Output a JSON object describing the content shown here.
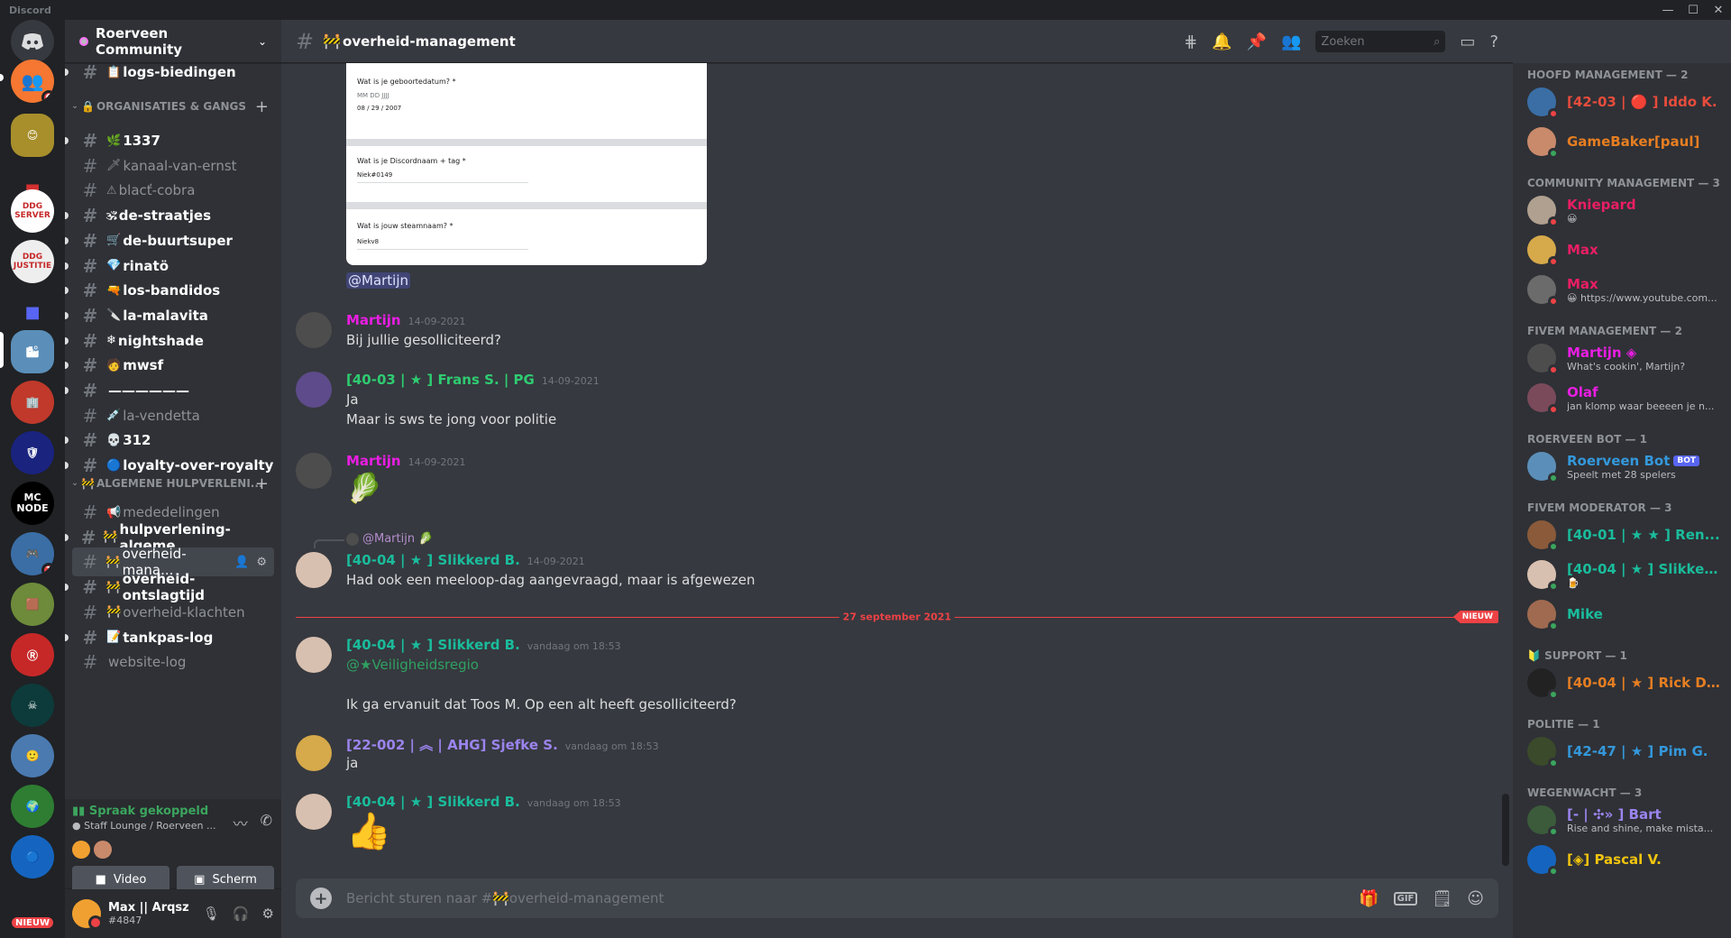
{
  "app": {
    "title": "Discord"
  },
  "window": {
    "minimize": "—",
    "maximize": "☐",
    "close": "✕"
  },
  "rail": {
    "home_label": "Discord",
    "dm_badge": "6",
    "servers": [
      "DDG SERVER",
      "DDG JUSTITIE",
      "MC NODE"
    ],
    "badge_2": "1",
    "nieuw": "NIEUW"
  },
  "guild": {
    "name": "Roerveen Community"
  },
  "channels": {
    "top": {
      "label": "logs-biedingen",
      "emoji": "📋"
    },
    "cat1": "ORGANISATIES & GANGS",
    "group1": [
      {
        "emoji": "🌿",
        "label": "1337"
      },
      {
        "emoji": "🗡",
        "label": "kanaal-van-ernst"
      },
      {
        "emoji": "⚠",
        "label": "blacť-cobra"
      },
      {
        "emoji": "🕉",
        "label": "de-straatjes"
      },
      {
        "emoji": "🛒",
        "label": "de-buurtsuper"
      },
      {
        "emoji": "💎",
        "label": "rinatö"
      },
      {
        "emoji": "🔫",
        "label": "los-bandidos"
      },
      {
        "emoji": "🔪",
        "label": "la-malavita"
      },
      {
        "emoji": "❄",
        "label": "nightshade"
      },
      {
        "emoji": "🧑",
        "label": "mwsf"
      },
      {
        "emoji": "",
        "label": "——————"
      },
      {
        "emoji": "💉",
        "label": "la-vendetta"
      },
      {
        "emoji": "💀",
        "label": "312"
      },
      {
        "emoji": "🔵",
        "label": "loyalty-over-royalty"
      }
    ],
    "cat2": "ALGEMENE HULPVERLENI...",
    "group2": [
      {
        "emoji": "📢",
        "label": "mededelingen"
      },
      {
        "emoji": "🚧",
        "label": "hulpverlening-algeme..."
      },
      {
        "emoji": "🚧",
        "label": "overheid-mana..."
      },
      {
        "emoji": "🚧",
        "label": "overheid-ontslagtijd"
      },
      {
        "emoji": "🚧",
        "label": "overheid-klachten"
      },
      {
        "emoji": "📝",
        "label": "tankpas-log"
      },
      {
        "emoji": "",
        "label": "website-log"
      }
    ]
  },
  "voice": {
    "status": "Spraak gekoppeld",
    "channel": "Staff Lounge / Roerveen ...",
    "video": "Video",
    "screen": "Scherm"
  },
  "user": {
    "name": "Max || Arqsz",
    "tag": "#4847"
  },
  "chat": {
    "channel_emoji": "🚧",
    "channel_name": "overheid-management",
    "search_placeholder": "Zoeken",
    "composer_placeholder": "Bericht sturen naar #🚧overheid-management"
  },
  "form_embed": {
    "q1": "Wat is je geboortedatum? *",
    "q1_fmt": "MM    DD     JJJJ",
    "q1_val": "08  /  29  /  2007",
    "q2": "Wat is je Discordnaam + tag *",
    "q2_val": "Niek#0149",
    "q3": "Wat is jouw steamnaam? *",
    "q3_val": "Niekv8"
  },
  "mention": "@Martijn",
  "messages": [
    {
      "author": "Martijn",
      "color": "#e91ee3",
      "time": "14-09-2021",
      "lines": [
        "Bij jullie gesolliciteerd?"
      ]
    },
    {
      "author": "[40-03 | ★ ] Frans S. | PG",
      "color": "#2ecc71",
      "time": "14-09-2021",
      "lines": [
        "Ja",
        "Maar is sws te jong voor politie"
      ]
    },
    {
      "author": "Martijn",
      "color": "#e91ee3",
      "time": "14-09-2021",
      "lines": [
        "🥬"
      ]
    },
    {
      "reply_to": "@Martijn 🥬",
      "author": "[40-04 | ★ ] Slikkerd B.",
      "color": "#1abc9c",
      "time": "14-09-2021",
      "lines": [
        "Had ook een meeloop-dag aangevraagd, maar is afgewezen"
      ]
    },
    {
      "author": "[40-04 | ★ ] Slikkerd B.",
      "color": "#1abc9c",
      "time": "vandaag om 18:53",
      "lines": [
        "@★Veiligheidsregio",
        "Ik ga ervanuit dat Toos M. Op een alt heeft gesolliciteerd?"
      ]
    },
    {
      "author": "[22-002 | ︽ | AHG] Sjefke S.",
      "color": "#9b84ee",
      "time": "vandaag om 18:53",
      "lines": [
        "ja"
      ]
    },
    {
      "author": "[40-04 | ★ ] Slikkerd B.",
      "color": "#1abc9c",
      "time": "vandaag om 18:53",
      "lines": [
        "👍"
      ]
    }
  ],
  "divider": {
    "date": "27 september 2021",
    "new": "NIEUW"
  },
  "member_groups": [
    {
      "title": "HOOFD MANAGEMENT — 2",
      "members": [
        {
          "name": "[42-03 | 🔴 ] Iddo K.",
          "color": "#e74c3c",
          "status": "",
          "st": "#ed4245"
        },
        {
          "name": "GameBaker[paul]",
          "color": "#e67e22",
          "status": "",
          "st": "#3ba55d"
        }
      ]
    },
    {
      "title": "COMMUNITY MANAGEMENT — 3",
      "members": [
        {
          "name": "Kniepard",
          "color": "#e91e63",
          "status": "😀",
          "st": "#ed4245"
        },
        {
          "name": "Max",
          "color": "#e91e63",
          "status": "",
          "st": "#ed4245"
        },
        {
          "name": "Max",
          "color": "#e91e63",
          "status": "😀 https://www.youtube.com...",
          "st": "#ed4245"
        }
      ]
    },
    {
      "title": "FIVEM MANAGEMENT — 2",
      "members": [
        {
          "name": "Martijn ◈",
          "color": "#e91ee3",
          "status": "What's cookin', Martijn?",
          "st": "#ed4245"
        },
        {
          "name": "Olaf",
          "color": "#e91ee3",
          "status": "jan klomp waar beeeen je n...",
          "st": "#ed4245"
        }
      ]
    },
    {
      "title": "ROERVEEN BOT — 1",
      "members": [
        {
          "name": "Roerveen Bot",
          "color": "#3498db",
          "status": "Speelt met 28 spelers",
          "st": "#3ba55d",
          "bot": "BOT"
        }
      ]
    },
    {
      "title": "FIVEM MODERATOR — 3",
      "members": [
        {
          "name": "[40-01 | ★ ★ ] Ren...",
          "color": "#1abc9c",
          "status": "",
          "st": "#3ba55d"
        },
        {
          "name": "[40-04 | ★ ] Slikkerd B.",
          "color": "#1abc9c",
          "status": "🍺",
          "st": "#3ba55d"
        },
        {
          "name": "Mike",
          "color": "#1abc9c",
          "status": "",
          "st": "#3ba55d"
        }
      ]
    },
    {
      "title": "🔰 SUPPORT — 1",
      "members": [
        {
          "name": "[40-04 | ★ ] Rick D...",
          "color": "#e67e22",
          "status": "",
          "st": "#3ba55d"
        }
      ]
    },
    {
      "title": "POLITIE — 1",
      "members": [
        {
          "name": "[42-47 | ★ ] Pim G.",
          "color": "#3498db",
          "status": "",
          "st": "#3ba55d"
        }
      ]
    },
    {
      "title": "WEGENWACHT — 3",
      "members": [
        {
          "name": "[- | ✣» ] Bart",
          "color": "#9b84ee",
          "status": "Rise and shine, make mista...",
          "st": "#3ba55d"
        },
        {
          "name": "[◈] Pascal V.",
          "color": "#f1c40f",
          "status": "",
          "st": "#3ba55d"
        }
      ]
    }
  ]
}
